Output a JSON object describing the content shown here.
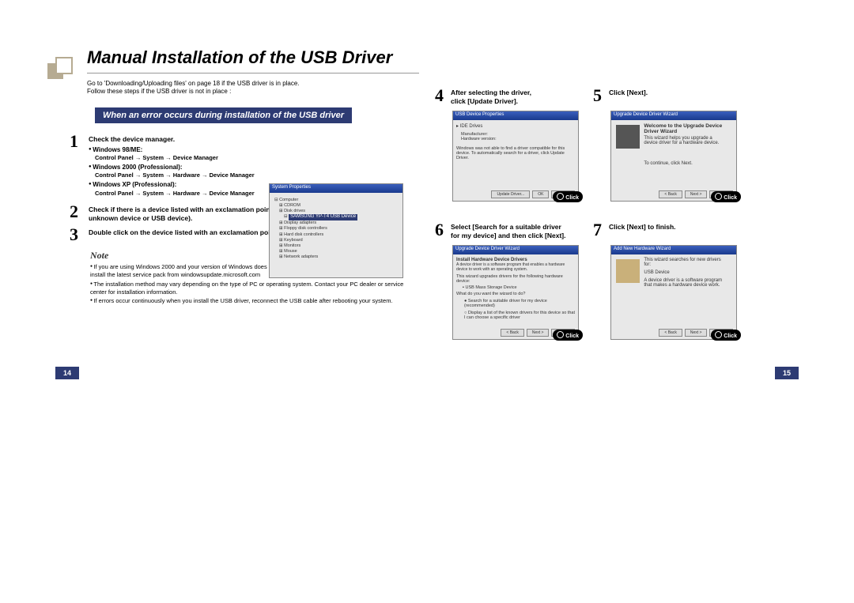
{
  "title": "Manual Installation of the USB Driver",
  "intro_line1": "Go to 'Downloading/Uploading files' on page 18 if the USB driver is in place.",
  "intro_line2": "Follow these steps if the USB driver is not in place :",
  "error_heading": "When an error occurs during installation of the USB driver",
  "step1": {
    "head": "Check the device manager.",
    "os": [
      {
        "name": "Windows 98/ME:",
        "path": "Control Panel  → System  → Device Manager"
      },
      {
        "name": "Windows 2000 (Professional):",
        "path": "Control Panel  → System  → Hardware  → Device Manager"
      },
      {
        "name": "Windows XP (Professional):",
        "path": "Control Panel  → System  → Hardware  → Device Manager"
      }
    ],
    "shot_sel": "SAMSUNG YP-T4 USB Device"
  },
  "step2": "Check if there is a device listed with an exclamation point or a question mark (displayed as unknown device or USB device).",
  "step3": "Double click on the device listed with an exclamation point or a question mark.",
  "note_head": "Note",
  "notes": [
    "If you are using Windows 2000 and your version of Windows does not recognize the USB driver please download and install the latest service pack from windowsupdate.microsoft.com",
    "The installation method may vary depending on the type of PC or operating system. Contact your PC dealer or service center for installation information.",
    "If errors occur continuously when you install the USB driver, reconnect the USB cable after rebooting your system."
  ],
  "page_left": "14",
  "page_right": "15",
  "step4": {
    "l1": "After selecting the driver,",
    "l2": "click [Update Driver].",
    "shot_title": "USB Device Properties",
    "shot_body": "Windows was not able to find a driver compatible for this device. To automatically search for a driver, click Update Driver.",
    "tab": "IDE Drives"
  },
  "step5": {
    "head": "Click [Next].",
    "shot_title": "Upgrade Device Driver Wizard",
    "wiz_title": "Welcome to the Upgrade Device Driver Wizard",
    "wiz_body": "This wizard helps you upgrade a device driver for a hardware device.",
    "wiz_cont": "To continue, click Next."
  },
  "step6": {
    "l1": "Select  [Search for a suitable driver",
    "l2": "for my device] and then click [Next].",
    "shot_title": "Upgrade Device Driver Wizard",
    "head1": "Install Hardware Device Drivers",
    "head2": "A device driver is a software program that enables a hardware device to work with an operating system.",
    "body": "This wizard upgrades drivers for the following hardware device:",
    "dev": "USB Mass Storage Device",
    "ask": "What do you want the wizard to do?",
    "opt1": "Search for a suitable driver for my device (recommended)",
    "opt2": "Display a list of the known drivers for this device so that I can choose a specific driver"
  },
  "step7": {
    "head": "Click [Next] to finish.",
    "shot_title": "Add New Hardware Wizard",
    "body1": "This wizard searches for new drivers for:",
    "dev": "USB Device",
    "body2": "A device driver is a software program that makes a hardware device work."
  },
  "click_label": "Click",
  "btn_next": "Next >",
  "btn_back": "< Back",
  "btn_cancel": "Cancel",
  "btn_ok": "OK"
}
